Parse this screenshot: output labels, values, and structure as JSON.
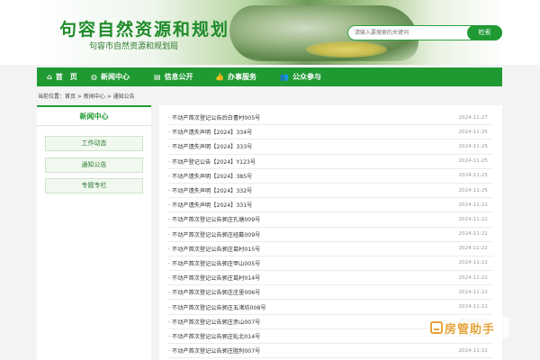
{
  "header": {
    "site_title": "句容自然资源和规划",
    "site_subtitle": "句容市自然资源和规划局",
    "search_placeholder": "请输入要搜索的关键词",
    "search_button": "检索"
  },
  "nav": {
    "items": [
      {
        "label": "首　页",
        "icon": "home-icon"
      },
      {
        "label": "新闻中心",
        "icon": "globe-icon"
      },
      {
        "label": "信息公开",
        "icon": "document-icon"
      },
      {
        "label": "办事服务",
        "icon": "thumbs-up-icon"
      },
      {
        "label": "公众参与",
        "icon": "people-icon"
      }
    ]
  },
  "breadcrumb": "当前位置：首页 > 新闻中心 > 通知公告",
  "sidebar": {
    "title": "新闻中心",
    "items": [
      "工作动态",
      "通知公告",
      "专题专栏"
    ]
  },
  "news": [
    {
      "title": "· 不动产首次登记公告后白曹村005号",
      "date": "2024-11-27"
    },
    {
      "title": "· 不动产遗失声明【2024】334号",
      "date": "2024-11-25"
    },
    {
      "title": "· 不动产遗失声明【2024】333号",
      "date": "2024-11-25"
    },
    {
      "title": "· 不动产登记公告【2024】Y123号",
      "date": "2024-11-25"
    },
    {
      "title": "· 不动产遗失声明【2024】385号",
      "date": "2024-11-25"
    },
    {
      "title": "· 不动产遗失声明【2024】332号",
      "date": "2024-11-25"
    },
    {
      "title": "· 不动产遗失声明【2024】331号",
      "date": "2024-11-22"
    },
    {
      "title": "· 不动产首次登记公告郭庄孔塘009号",
      "date": "2024-11-22"
    },
    {
      "title": "· 不动产首次登记公告郭庄经戴009号",
      "date": "2024-11-22"
    },
    {
      "title": "· 不动产首次登记公告郭庄葛村015号",
      "date": "2024-11-22"
    },
    {
      "title": "· 不动产首次登记公告郭庄甲山005号",
      "date": "2024-11-22"
    },
    {
      "title": "· 不动产首次登记公告郭庄葛村014号",
      "date": "2024-11-22"
    },
    {
      "title": "· 不动产首次登记公告郭庄庄里006号",
      "date": "2024-11-22"
    },
    {
      "title": "· 不动产首次登记公告郭庄五渚坊008号",
      "date": "2024-11-22"
    },
    {
      "title": "· 不动产首次登记公告郭庄赤山007号",
      "date": "2024-11-22"
    },
    {
      "title": "· 不动产首次登记公告郭庄虬北014号",
      "date": "2024-11-22"
    },
    {
      "title": "· 不动产首次登记公告郭庄胜利007号",
      "date": "2024-11-22"
    }
  ],
  "watermark": "房管助手",
  "colors": {
    "brand_green": "#1f9a32",
    "watermark_orange": "#e6a33a"
  }
}
